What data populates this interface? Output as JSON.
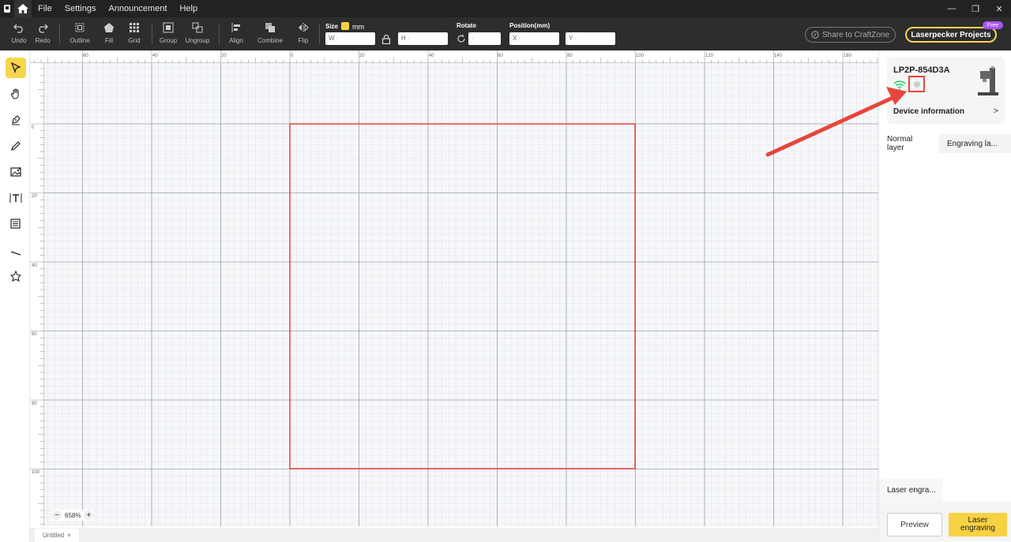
{
  "menu": {
    "file": "File",
    "settings": "Settings",
    "announcement": "Announcement",
    "help": "Help"
  },
  "toolbar": {
    "undo": "Undo",
    "redo": "Redo",
    "outline": "Outline",
    "fill": "Fill",
    "grid": "Grid",
    "group": "Group",
    "ungroup": "Ungroup",
    "align": "Align",
    "combine": "Combine",
    "flip": "Flip",
    "size_label": "Size",
    "unit": "mm",
    "w_prefix": "W",
    "h_prefix": "H",
    "rotate_label": "Rotate",
    "position_label": "Position(mm)",
    "x_prefix": "X",
    "y_prefix": "Y",
    "share": "Share to CraftZone",
    "projects": "Laserpecker Projects",
    "free_badge": "Free"
  },
  "ruler": {
    "h_ticks": [
      "60",
      "40",
      "20",
      "0",
      "20",
      "40",
      "60",
      "80",
      "100",
      "120",
      "140",
      "160"
    ],
    "v_ticks": [
      "0",
      "20",
      "40",
      "60",
      "80",
      "100"
    ]
  },
  "zoom": {
    "value": "658%"
  },
  "document_tab": {
    "name": "Untitled",
    "close": "×"
  },
  "device": {
    "name": "LP2P-854D3A",
    "info_label": "Device information",
    "arrow": ">"
  },
  "panel": {
    "tab_normal": "Normal layer",
    "tab_engraving": "Engraving la...",
    "tab_laser": "Laser engra...",
    "preview": "Preview",
    "engrave": "Laser engraving"
  },
  "colors": {
    "accent": "#f8d243",
    "selection": "#e53935",
    "annotation_arrow": "#e8453c",
    "wifi": "#22c55e",
    "free_badge": "#a855f7"
  }
}
